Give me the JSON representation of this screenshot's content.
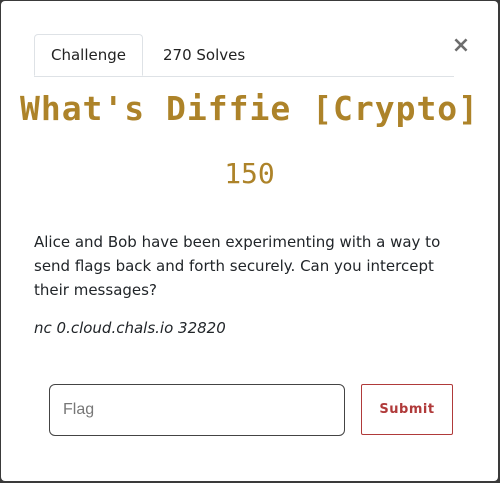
{
  "tabs": [
    {
      "label": "Challenge",
      "active": true
    },
    {
      "label": "270 Solves",
      "active": false
    }
  ],
  "close_symbol": "×",
  "challenge": {
    "title": "What's Diffie [Crypto]",
    "points": "150",
    "description": "Alice and Bob have been experimenting with a way to send flags back and forth securely. Can you intercept their messages?",
    "connection": "nc 0.cloud.chals.io 32820"
  },
  "form": {
    "flag_placeholder": "Flag",
    "submit_label": "Submit"
  },
  "colors": {
    "title": "#ad8329",
    "submit": "#b03a3a"
  }
}
